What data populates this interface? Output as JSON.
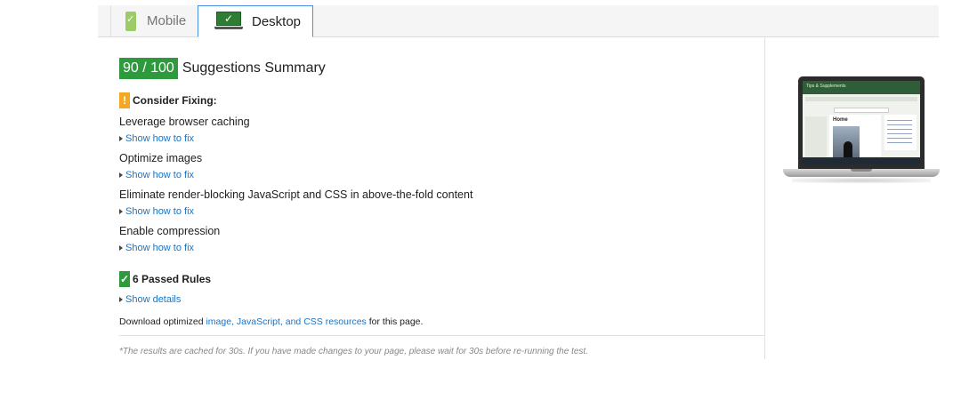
{
  "tabs": {
    "mobile_label": "Mobile",
    "desktop_label": "Desktop"
  },
  "summary": {
    "score": "90 / 100",
    "title": "Suggestions Summary"
  },
  "consider_fixing": {
    "icon": "!",
    "heading": "Consider Fixing:",
    "rules": [
      {
        "label": "Leverage browser caching",
        "link": "Show how to fix"
      },
      {
        "label": "Optimize images",
        "link": "Show how to fix"
      },
      {
        "label": "Eliminate render-blocking JavaScript and CSS in above-the-fold content",
        "link": "Show how to fix"
      },
      {
        "label": "Enable compression",
        "link": "Show how to fix"
      }
    ]
  },
  "passed": {
    "heading": "6 Passed Rules",
    "link": "Show details"
  },
  "download": {
    "prefix": "Download optimized ",
    "link": "image, JavaScript, and CSS resources",
    "suffix": " for this page."
  },
  "footnote": "*The results are cached for 30s. If you have made changes to your page, please wait for 30s before re-running the test.",
  "preview": {
    "site_title": "Tips & Supplements",
    "page_heading": "Home"
  },
  "colors": {
    "score_green": "#2e9a3e",
    "warning_orange": "#f5a623",
    "link_blue": "#1a73c4",
    "tab_active_border": "#4a90e2"
  }
}
